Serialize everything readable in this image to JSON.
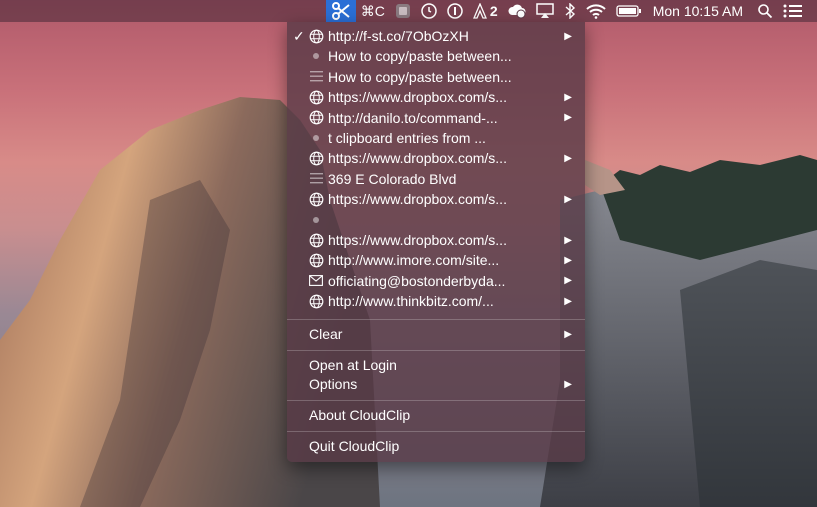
{
  "menubar": {
    "items": [
      {
        "icon": "scissors-icon",
        "active": true
      },
      {
        "text": "⌘C"
      },
      {
        "icon": "app-icon"
      },
      {
        "icon": "clock-alert-icon"
      },
      {
        "icon": "info-circle-icon"
      },
      {
        "icon": "adobe-icon",
        "text": "2"
      },
      {
        "icon": "cloud-sync-icon"
      },
      {
        "icon": "airplay-icon"
      },
      {
        "icon": "bluetooth-icon"
      },
      {
        "icon": "wifi-icon"
      },
      {
        "icon": "battery-icon"
      }
    ],
    "clock": "Mon 10:15 AM",
    "search_icon": "spotlight-search-icon",
    "notification_icon": "notification-center-icon"
  },
  "menu": {
    "clips": [
      {
        "label": "http://f-st.co/7ObOzXH",
        "icon": "globe-icon",
        "checked": true,
        "submenu": true
      },
      {
        "label": "How to copy/paste between...",
        "icon": "dot-icon",
        "submenu": false
      },
      {
        "label": "How to copy/paste between...",
        "icon": "lines-icon",
        "submenu": false
      },
      {
        "label": "https://www.dropbox.com/s...",
        "icon": "globe-icon",
        "submenu": true
      },
      {
        "label": "http://danilo.to/command-...",
        "icon": "globe-icon",
        "submenu": true
      },
      {
        "label": "t clipboard entries from ...",
        "icon": "dot-icon",
        "submenu": false
      },
      {
        "label": "https://www.dropbox.com/s...",
        "icon": "globe-icon",
        "submenu": true
      },
      {
        "label": "369 E Colorado Blvd",
        "icon": "lines-icon",
        "submenu": false
      },
      {
        "label": "https://www.dropbox.com/s...",
        "icon": "globe-icon",
        "submenu": true
      },
      {
        "label": "",
        "icon": "dot-icon",
        "submenu": false
      },
      {
        "label": "https://www.dropbox.com/s...",
        "icon": "globe-icon",
        "submenu": true
      },
      {
        "label": "http://www.imore.com/site...",
        "icon": "globe-icon",
        "submenu": true
      },
      {
        "label": "officiating@bostonderbyda...",
        "icon": "envelope-icon",
        "submenu": true
      },
      {
        "label": "http://www.thinkbitz.com/...",
        "icon": "globe-icon",
        "submenu": true
      }
    ],
    "clear_label": "Clear",
    "open_at_login_label": "Open at Login",
    "options_label": "Options",
    "about_label": "About CloudClip",
    "quit_label": "Quit CloudClip",
    "submenu_arrow": "▶",
    "checkmark": "✓"
  }
}
